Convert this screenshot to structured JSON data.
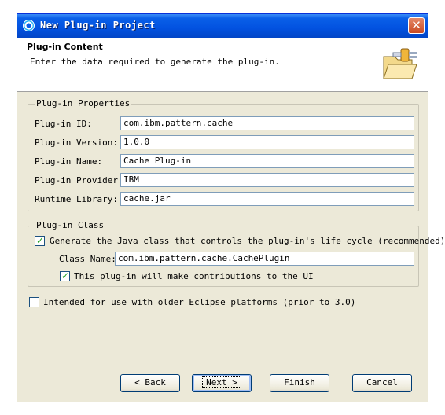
{
  "window": {
    "title": "New Plug-in Project",
    "close_icon": "close-icon"
  },
  "banner": {
    "title": "Plug-in Content",
    "description": "Enter the data required to generate the plug-in.",
    "icon": "folder-plug-icon"
  },
  "properties": {
    "group_title": "Plug-in Properties",
    "fields": [
      {
        "label": "Plug-in ID:",
        "value": "com.ibm.pattern.cache"
      },
      {
        "label": "Plug-in Version:",
        "value": "1.0.0"
      },
      {
        "label": "Plug-in Name:",
        "value": "Cache Plug-in"
      },
      {
        "label": "Plug-in Provider:",
        "value": "IBM"
      },
      {
        "label": "Runtime Library:",
        "value": "cache.jar"
      }
    ]
  },
  "plugin_class": {
    "group_title": "Plug-in Class",
    "generate_label": "Generate the Java class that controls the plug-in's life cycle (recommended)",
    "generate_checked": true,
    "class_name_label": "Class Name:",
    "class_name_value": "com.ibm.pattern.cache.CachePlugin",
    "contributions_label": "This plug-in will make contributions to the UI",
    "contributions_checked": true
  },
  "legacy": {
    "label": "Intended for use with older Eclipse platforms (prior to 3.0)",
    "checked": false
  },
  "buttons": {
    "back": "< Back",
    "next": "Next >",
    "finish": "Finish",
    "cancel": "Cancel"
  }
}
